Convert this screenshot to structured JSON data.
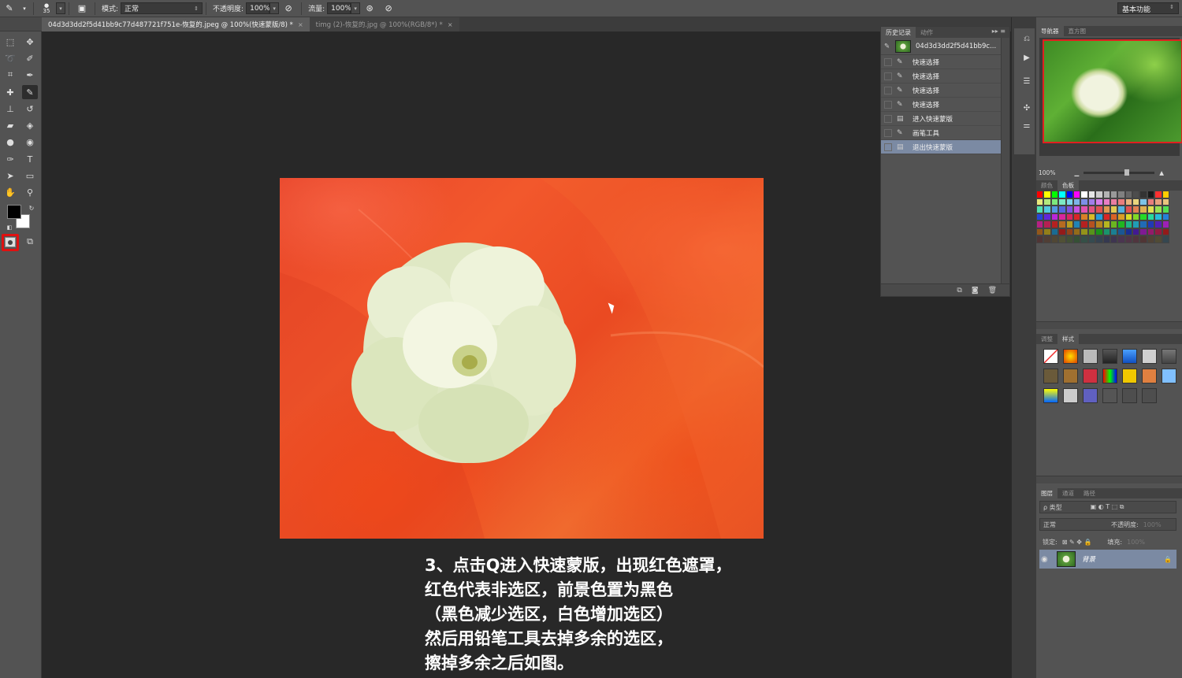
{
  "options_bar": {
    "brush_size": "35",
    "mode_label": "模式:",
    "mode_value": "正常",
    "opacity_label": "不透明度:",
    "opacity_value": "100%",
    "flow_label": "流量:",
    "flow_value": "100%",
    "workspace": "基本功能"
  },
  "tabs": [
    {
      "label": "04d3d3dd2f5d41bb9c77d487721f751e-恢复的.jpeg @ 100%(快速蒙版/8) *",
      "active": true
    },
    {
      "label": "timg (2)-恢复的.jpg @ 100%(RGB/8*) *",
      "active": false
    }
  ],
  "caption": [
    "3、点击Q进入快速蒙版，出现红色遮罩，",
    "红色代表非选区，前景色置为黑色",
    "（黑色减少选区，白色增加选区）",
    "然后用铅笔工具去掉多余的选区，",
    "擦掉多余之后如图。"
  ],
  "history": {
    "tabs": [
      "历史记录",
      "动作"
    ],
    "snapshot": "04d3d3dd2f5d41bb9c...",
    "items": [
      {
        "label": "快速选择",
        "icon": "brush-icon"
      },
      {
        "label": "快速选择",
        "icon": "brush-icon"
      },
      {
        "label": "快速选择",
        "icon": "brush-icon"
      },
      {
        "label": "快速选择",
        "icon": "brush-icon"
      },
      {
        "label": "进入快速蒙版",
        "icon": "document-icon"
      },
      {
        "label": "画笔工具",
        "icon": "brush-icon"
      },
      {
        "label": "退出快速蒙版",
        "icon": "document-icon",
        "selected": true
      }
    ]
  },
  "navigator": {
    "tabs": [
      "导航器",
      "直方图"
    ],
    "zoom": "100%"
  },
  "color_panel": {
    "tabs": [
      "颜色",
      "色板"
    ]
  },
  "styles_panel": {
    "tabs": [
      "调整",
      "样式"
    ]
  },
  "layers_panel": {
    "tabs": [
      "图层",
      "通道",
      "路径"
    ],
    "kind_label": "ρ 类型",
    "blend_mode": "正常",
    "opacity_label": "不透明度:",
    "opacity_value": "100%",
    "lock_label": "锁定:",
    "fill_label": "填充:",
    "fill_value": "100%",
    "layer_name": "背景"
  },
  "colors": {
    "accent_selected": "#7b8aa3",
    "highlight_red": "#e01010"
  }
}
